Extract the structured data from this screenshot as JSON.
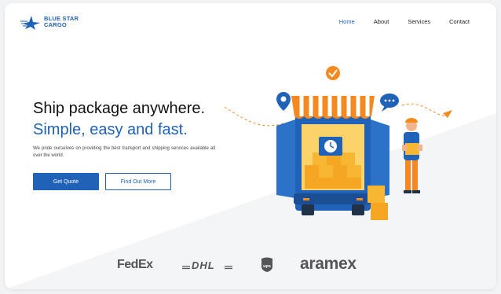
{
  "brand": {
    "line1": "BLUE STAR",
    "line2": "CARGO"
  },
  "nav": {
    "items": [
      "Home",
      "About",
      "Services",
      "Contact"
    ],
    "active": "Home"
  },
  "hero": {
    "title": "Ship package anywhere.",
    "subtitle": "Simple, easy and fast.",
    "description": "We pride ourselves on providing the best transport and shipping services available all over the world.",
    "primary_button": "Get Quote",
    "secondary_button": "Find Out More"
  },
  "partners": {
    "fedex": "FedEx",
    "dhl": "DHL",
    "ups": "ups",
    "aramex": "aramex"
  },
  "colors": {
    "brand_blue": "#1f62b8",
    "accent_orange": "#f5881f",
    "text_dark": "#111111"
  }
}
